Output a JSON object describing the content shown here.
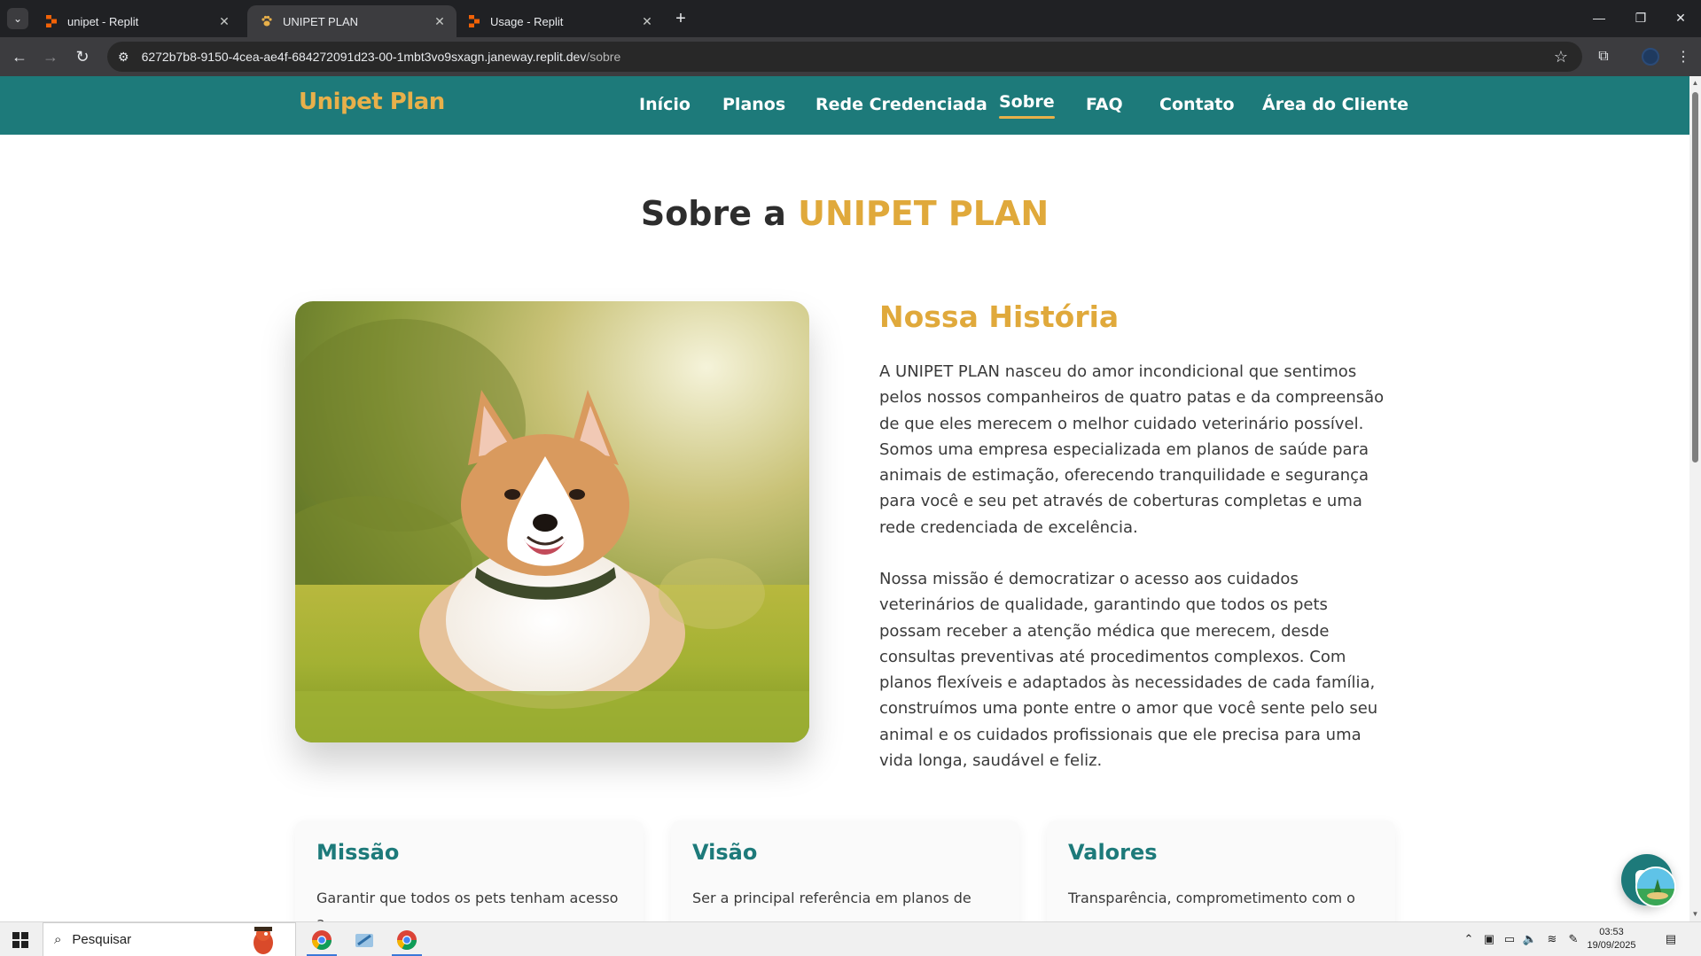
{
  "browser": {
    "tabs": [
      {
        "title": "unipet - Replit",
        "icon": "replit-icon"
      },
      {
        "title": "UNIPET PLAN",
        "icon": "paw-icon"
      },
      {
        "title": "Usage - Replit",
        "icon": "replit-icon"
      }
    ],
    "active_tab": 1,
    "url_host": "6272b7b8-9150-4cea-ae4f-684272091d23-00-1mbt3vo9sxagn.janeway.replit.dev",
    "url_path": "/sobre"
  },
  "site": {
    "logo": "Unipet Plan",
    "nav": [
      "Início",
      "Planos",
      "Rede Credenciada",
      "Sobre",
      "FAQ",
      "Contato",
      "Área do Cliente"
    ],
    "active_nav": "Sobre"
  },
  "page": {
    "title_prefix": "Sobre a",
    "title_accent": "UNIPET PLAN",
    "story_title": "Nossa História",
    "story_p1": "A UNIPET PLAN nasceu do amor incondicional que sentimos pelos nossos companheiros de quatro patas e da compreensão de que eles merecem o melhor cuidado veterinário possível. Somos uma empresa especializada em planos de saúde para animais de estimação, oferecendo tranquilidade e segurança para você e seu pet através de coberturas completas e uma rede credenciada de excelência.",
    "story_p2": "Nossa missão é democratizar o acesso aos cuidados veterinários de qualidade, garantindo que todos os pets possam receber a atenção médica que merecem, desde consultas preventivas até procedimentos complexos. Com planos flexíveis e adaptados às necessidades de cada família, construímos uma ponte entre o amor que você sente pelo seu animal e os cuidados profissionais que ele precisa para uma vida longa, saudável e feliz.",
    "cards": [
      {
        "title": "Missão",
        "text": "Garantir que todos os pets tenham acesso a"
      },
      {
        "title": "Visão",
        "text": "Ser a principal referência em planos de"
      },
      {
        "title": "Valores",
        "text": "Transparência, comprometimento com o"
      }
    ]
  },
  "taskbar": {
    "search_placeholder": "Pesquisar",
    "time": "03:53",
    "date": "19/09/2025"
  },
  "colors": {
    "brand_teal": "#1d7a7a",
    "brand_gold": "#e0a93b"
  }
}
